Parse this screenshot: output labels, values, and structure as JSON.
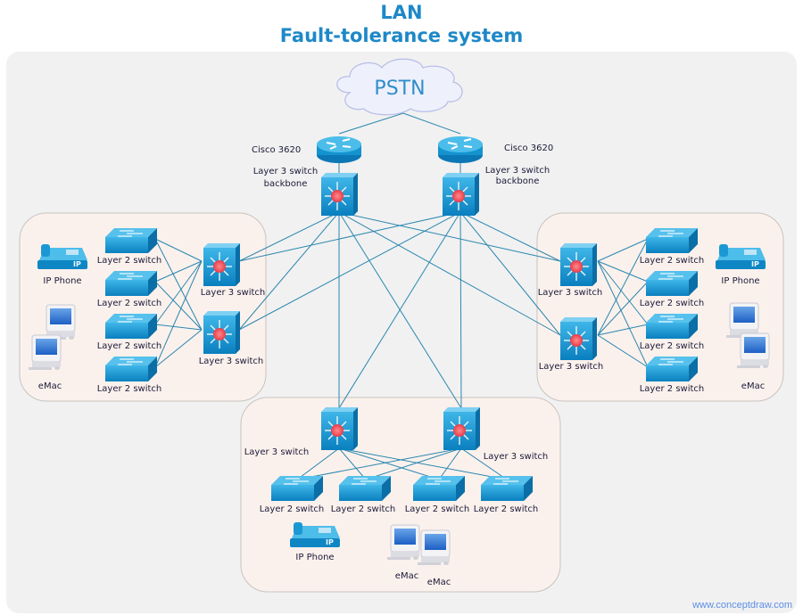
{
  "title": {
    "line1": "LAN",
    "line2": "Fault-tolerance system"
  },
  "colors": {
    "title": "#1e88c7",
    "link": "#2b87b0",
    "device": "#1b98d0",
    "group_bg": "#fbf1ec",
    "canvas_bg": "#f1f1f1"
  },
  "cloud": {
    "label": "PSTN"
  },
  "core": {
    "routers": [
      {
        "label": "Cisco 3620"
      },
      {
        "label": "Cisco 3620"
      }
    ],
    "switches": [
      {
        "label_line1": "Layer 3 switch",
        "label_line2": "backbone"
      },
      {
        "label_line1": "Layer 3 switch",
        "label_line2": "backbone"
      }
    ]
  },
  "groups": {
    "left": {
      "l3": [
        "Layer 3 switch",
        "Layer 3 switch"
      ],
      "l2": [
        "Layer 2 switch",
        "Layer 2 switch",
        "Layer 2 switch",
        "Layer 2 switch"
      ],
      "phone": "IP Phone",
      "emac": "eMac"
    },
    "right": {
      "l3": [
        "Layer 3 switch",
        "Layer 3 switch"
      ],
      "l2": [
        "Layer 2 switch",
        "Layer 2 switch",
        "Layer 2 switch",
        "Layer 2 switch"
      ],
      "phone": "IP Phone",
      "emac": "eMac"
    },
    "bottom": {
      "l3": [
        "Layer 3 switch",
        "Layer 3 switch"
      ],
      "l2": [
        "Layer 2 switch",
        "Layer 2 switch",
        "Layer 2 switch",
        "Layer 2 switch"
      ],
      "phone": "IP Phone",
      "emac": [
        "eMac",
        "eMac"
      ]
    }
  },
  "watermark": "www.conceptdraw.com"
}
